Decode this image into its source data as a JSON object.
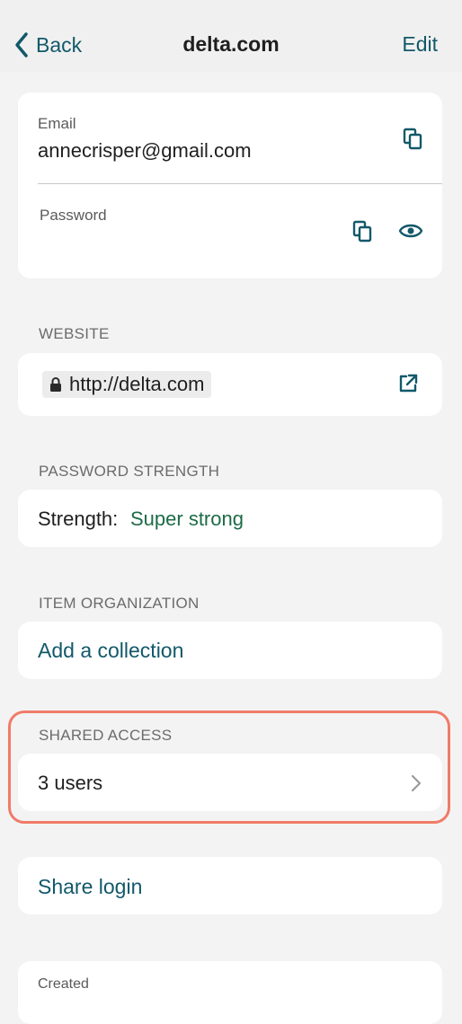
{
  "nav": {
    "back_label": "Back",
    "title": "delta.com",
    "edit_label": "Edit"
  },
  "credentials": {
    "email_label": "Email",
    "email_value": "annecrisper@gmail.com",
    "password_label": "Password"
  },
  "website": {
    "header": "WEBSITE",
    "url": "http://delta.com"
  },
  "strength": {
    "header": "PASSWORD STRENGTH",
    "label": "Strength:",
    "value": "Super strong",
    "value_color": "#1d6b47"
  },
  "organization": {
    "header": "ITEM ORGANIZATION",
    "add_collection": "Add a collection"
  },
  "shared": {
    "header": "SHARED ACCESS",
    "users": "3 users",
    "highlight_color": "#f07b68"
  },
  "share_login": "Share login",
  "created": {
    "label": "Created"
  },
  "colors": {
    "accent": "#12596a",
    "background": "#f3f3f3"
  },
  "icons": [
    "chevron-left-icon",
    "copy-icon",
    "eye-icon",
    "lock-icon",
    "external-link-icon",
    "chevron-right-icon"
  ]
}
